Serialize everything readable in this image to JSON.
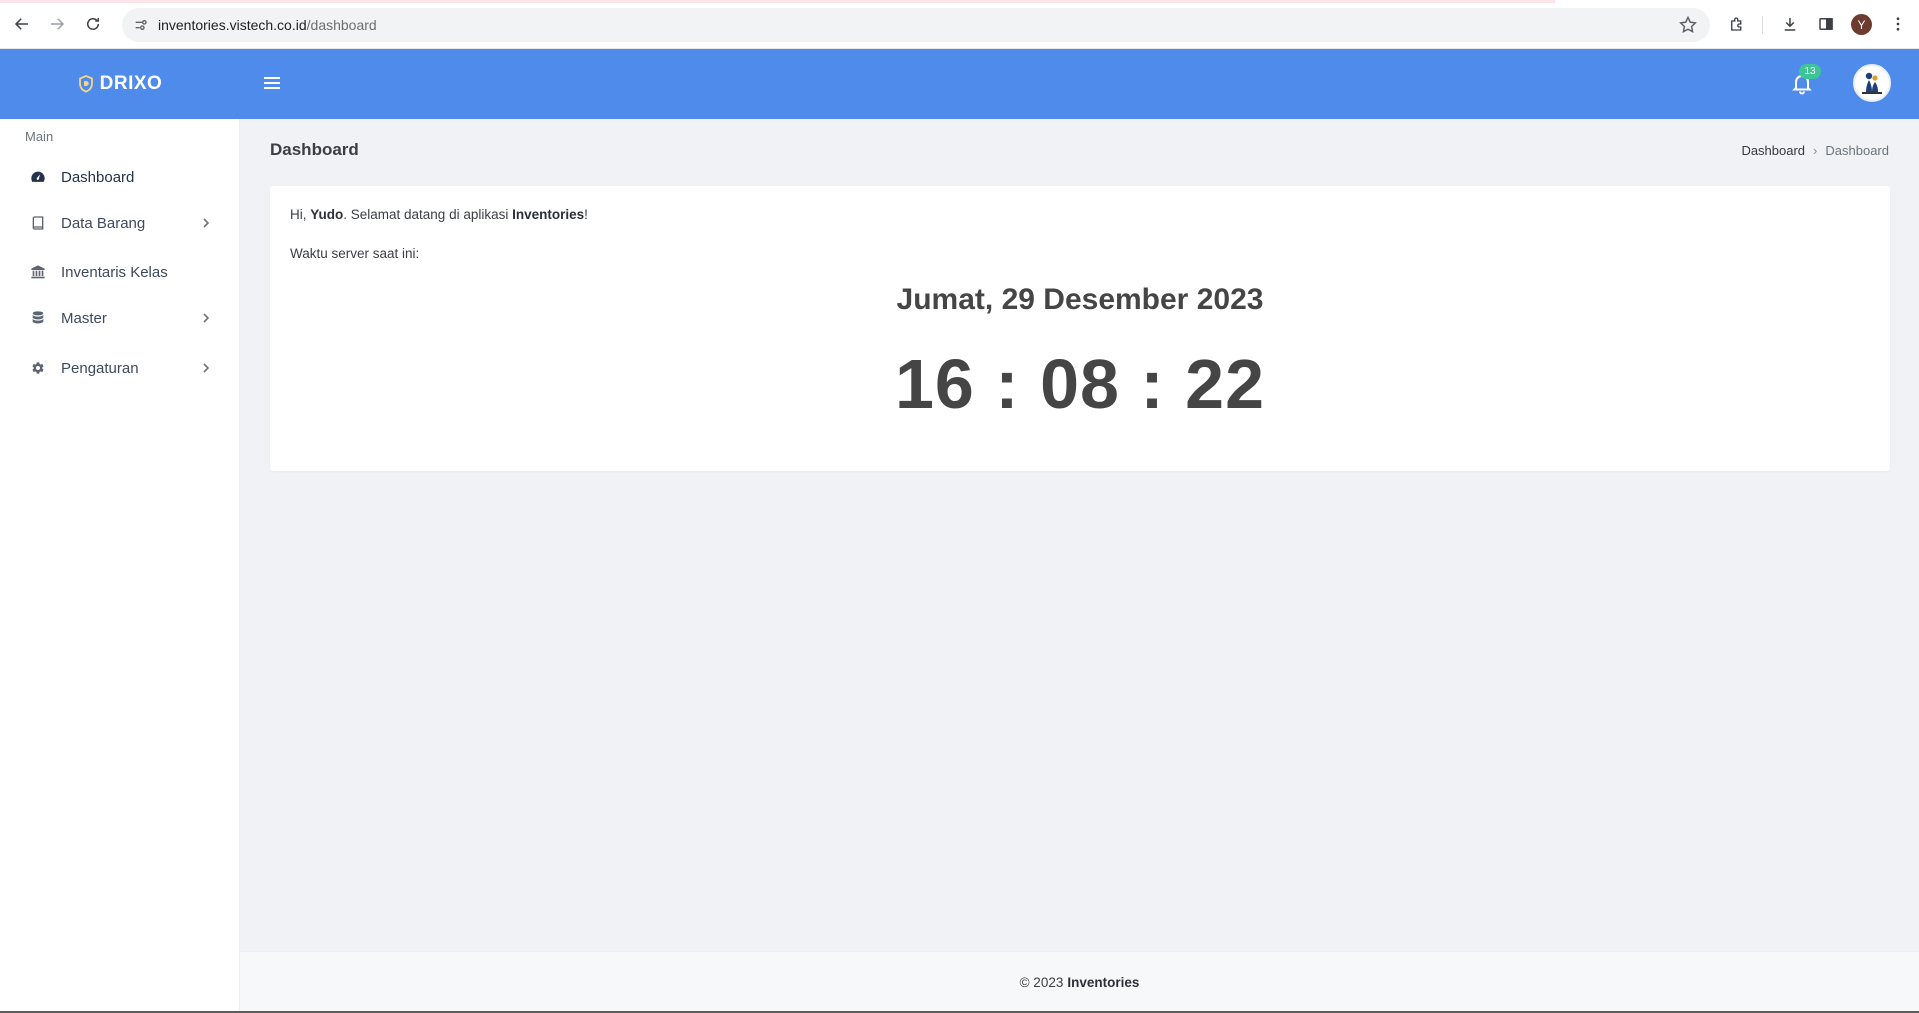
{
  "browser": {
    "url_host": "inventories.vistech.co.id",
    "url_path": "/dashboard",
    "profile_initial": "Y"
  },
  "app": {
    "brand": "DRIXO",
    "notification_count": "13",
    "accent_color": "#4f8bea",
    "badge_color": "#3ec596"
  },
  "sidebar": {
    "section_title": "Main",
    "items": [
      {
        "label": "Dashboard",
        "icon": "dashboard-gauge-icon",
        "has_submenu": false,
        "active": true
      },
      {
        "label": "Data Barang",
        "icon": "book-icon",
        "has_submenu": true
      },
      {
        "label": "Inventaris Kelas",
        "icon": "bank-icon",
        "has_submenu": false
      },
      {
        "label": "Master",
        "icon": "database-icon",
        "has_submenu": true
      },
      {
        "label": "Pengaturan",
        "icon": "gear-icon",
        "has_submenu": true
      }
    ]
  },
  "page": {
    "title": "Dashboard",
    "breadcrumb": [
      "Dashboard",
      "Dashboard"
    ]
  },
  "welcome": {
    "hi": "Hi, ",
    "user": "Yudo",
    "middle": ". Selamat datang di aplikasi ",
    "app_name": "Inventories",
    "end": "!",
    "server_time_label": "Waktu server saat ini:",
    "date": "Jumat, 29 Desember 2023",
    "time": "16 : 08 : 22"
  },
  "footer": {
    "copyright": "© 2023",
    "brand": "Inventories"
  }
}
